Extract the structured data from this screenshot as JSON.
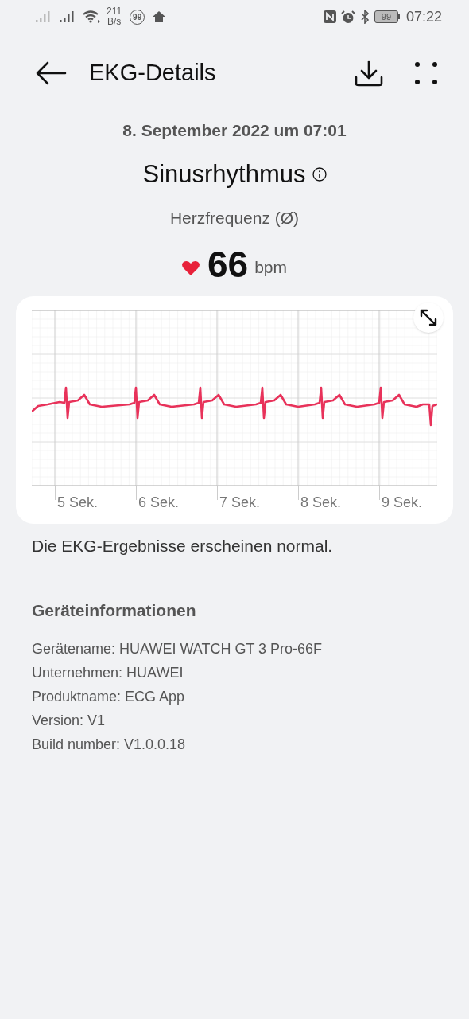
{
  "status_bar": {
    "network_speed": "211",
    "network_unit": "B/s",
    "notification_badge": "99",
    "battery": "99",
    "time": "07:22"
  },
  "header": {
    "title": "EKG-Details"
  },
  "recording": {
    "date": "8. September 2022 um 07:01",
    "rhythm": "Sinusrhythmus",
    "heart_rate_label": "Herzfrequenz (Ø)",
    "heart_rate": "66",
    "unit": "bpm"
  },
  "ecg": {
    "axis_labels": [
      "5 Sek.",
      "6 Sek.",
      "7 Sek.",
      "8 Sek.",
      "9 Sek."
    ]
  },
  "result": "Die EKG-Ergebnisse erscheinen normal.",
  "device_info": {
    "heading": "Geräteinformationen",
    "lines": [
      "Gerätename: HUAWEI WATCH GT 3 Pro-66F",
      "Unternehmen: HUAWEI",
      "Produktname: ECG App",
      "Version: V1",
      "Build number: V1.0.0.18"
    ]
  }
}
